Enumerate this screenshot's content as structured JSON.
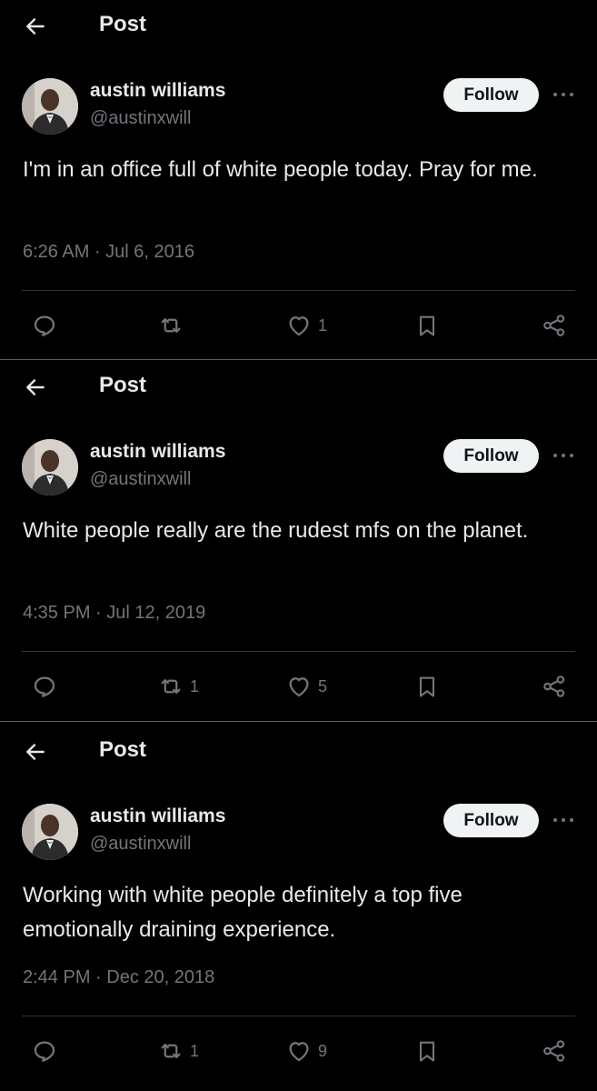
{
  "posts": [
    {
      "header": {
        "title": "Post"
      },
      "author": {
        "name": "austin williams",
        "handle": "@austinxwill"
      },
      "follow_label": "Follow",
      "text": "I'm in an office full of white people today. Pray for me.",
      "timestamp": "6:26 AM · Jul 6, 2016",
      "stats": {
        "replies": "",
        "reposts": "",
        "likes": "1"
      }
    },
    {
      "header": {
        "title": "Post"
      },
      "author": {
        "name": "austin williams",
        "handle": "@austinxwill"
      },
      "follow_label": "Follow",
      "text": "White people really are the rudest mfs on the planet.",
      "timestamp": "4:35 PM · Jul 12, 2019",
      "stats": {
        "replies": "",
        "reposts": "1",
        "likes": "5"
      }
    },
    {
      "header": {
        "title": "Post"
      },
      "author": {
        "name": "austin williams",
        "handle": "@austinxwill"
      },
      "follow_label": "Follow",
      "text": "Working with white people definitely a top five emotionally draining experience.",
      "timestamp": "2:44 PM · Dec 20, 2018",
      "stats": {
        "replies": "",
        "reposts": "1",
        "likes": "9"
      }
    }
  ],
  "icons": {
    "back": "arrow-left-icon",
    "more": "more-dots-icon",
    "reply": "reply-bubble-icon",
    "repost": "repost-icon",
    "like": "heart-icon",
    "bookmark": "bookmark-icon",
    "share": "share-icon"
  },
  "colors": {
    "background": "#000000",
    "text": "#e7e9ea",
    "muted": "#71767b",
    "follow_bg": "#eff3f4",
    "divider": "#2f3336"
  }
}
